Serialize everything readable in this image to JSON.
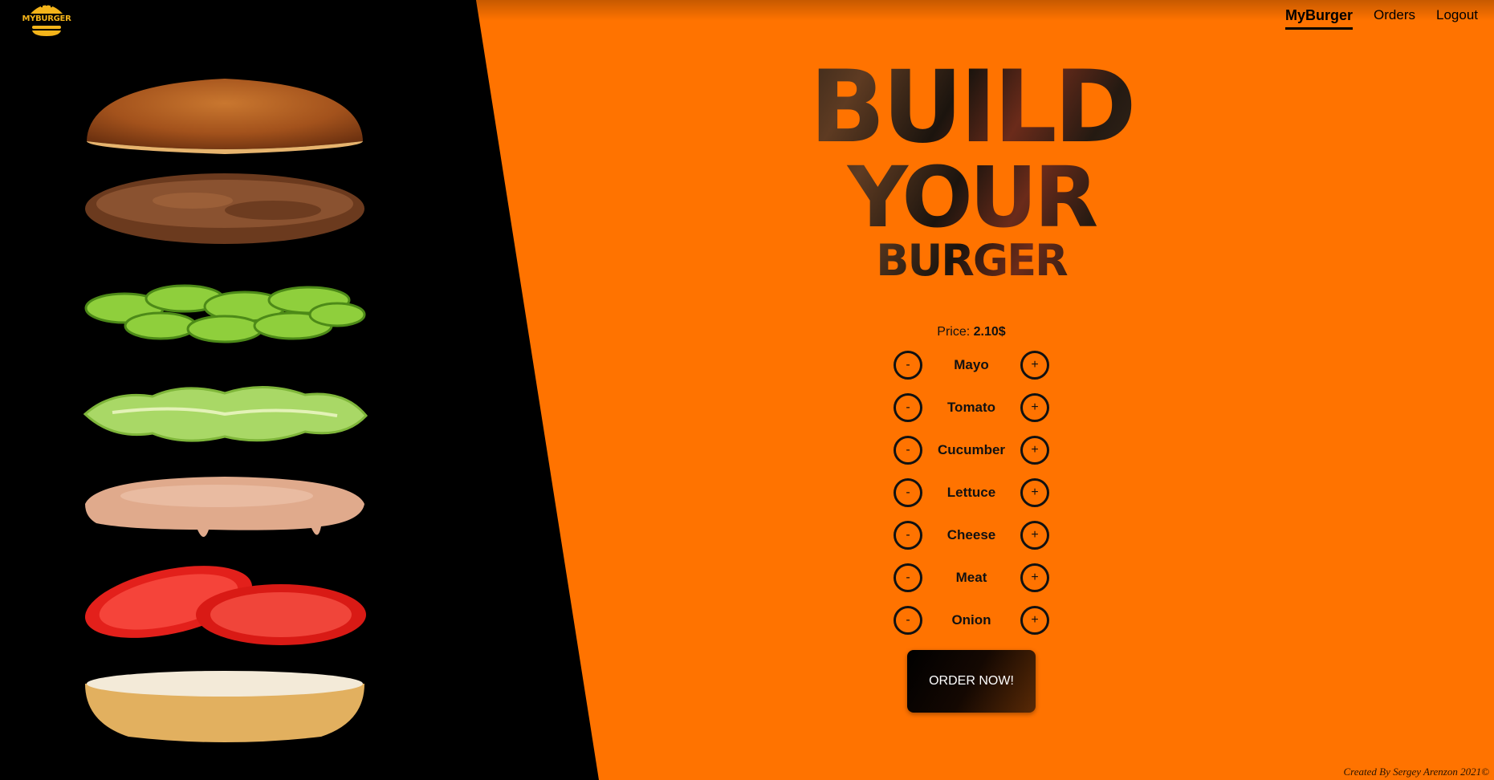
{
  "logo": {
    "text": "MYBURGER",
    "icon": "burger-icon",
    "color": "#f4b41a"
  },
  "nav": [
    {
      "label": "MyBurger",
      "active": true
    },
    {
      "label": "Orders",
      "active": false
    },
    {
      "label": "Logout",
      "active": false
    }
  ],
  "colors": {
    "accent": "#ff7300",
    "left_panel": "#000000"
  },
  "stack": [
    {
      "name": "top-bun"
    },
    {
      "name": "meat-patty"
    },
    {
      "name": "cucumber-slices"
    },
    {
      "name": "lettuce-leaf"
    },
    {
      "name": "mayo-sauce"
    },
    {
      "name": "tomato-slices"
    },
    {
      "name": "bottom-bun"
    }
  ],
  "title": {
    "line1": "BUILD",
    "line2": "YOUR",
    "line3": "BURGER"
  },
  "price": {
    "label": "Price:",
    "value": "2.10$"
  },
  "controls": {
    "minus": "-",
    "plus": "+",
    "ingredients": [
      {
        "name": "Mayo"
      },
      {
        "name": "Tomato"
      },
      {
        "name": "Cucumber"
      },
      {
        "name": "Lettuce"
      },
      {
        "name": "Cheese"
      },
      {
        "name": "Meat"
      },
      {
        "name": "Onion"
      }
    ]
  },
  "order_button": "ORDER NOW!",
  "footer": "Created By Sergey Arenzon 2021©"
}
